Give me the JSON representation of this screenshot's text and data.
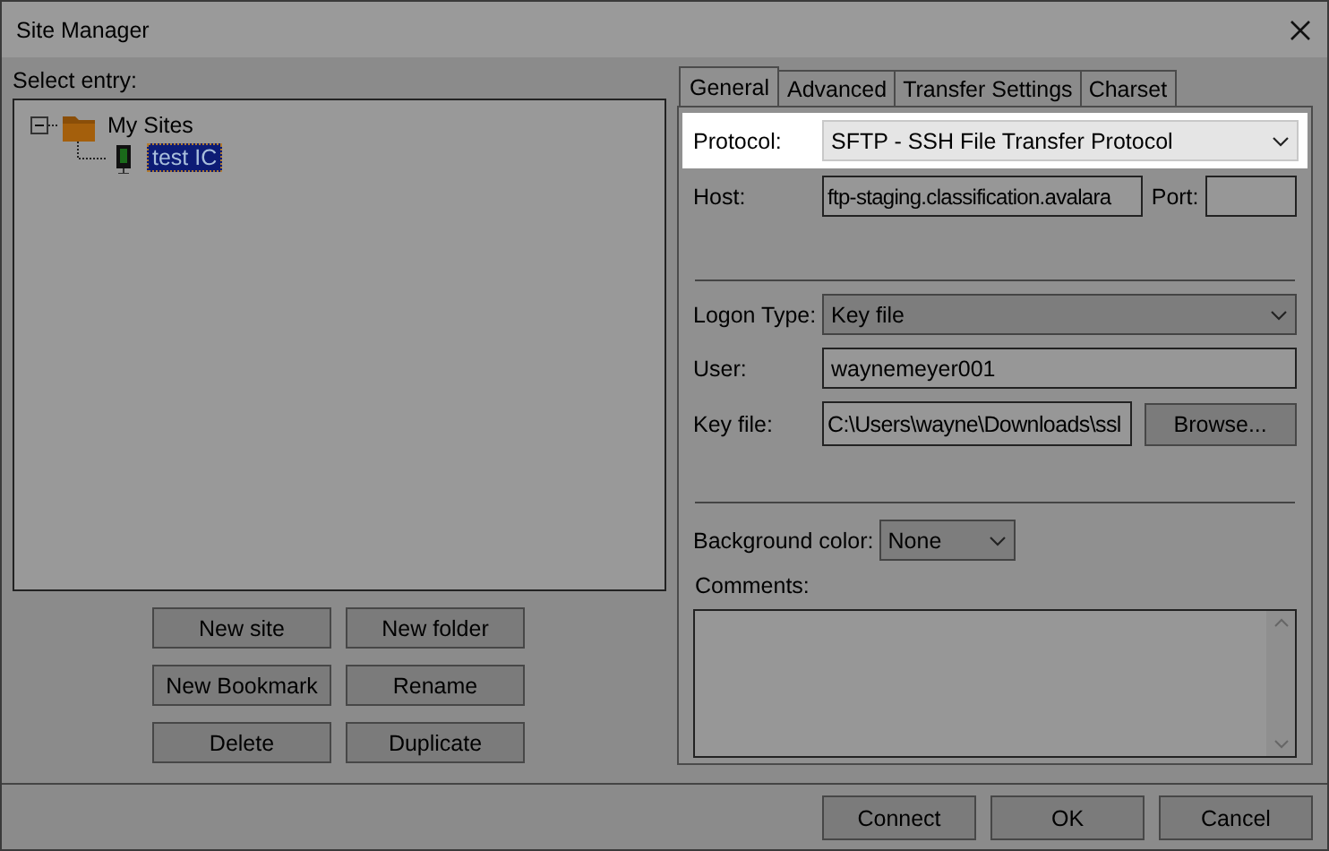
{
  "window": {
    "title": "Site Manager"
  },
  "select_entry_label": "Select entry:",
  "tree": [
    {
      "label": "My Sites",
      "kind": "folder",
      "expanded": true,
      "selected": false,
      "children": [
        {
          "label": "test IC",
          "kind": "site",
          "selected": true
        }
      ]
    }
  ],
  "site_buttons": [
    "New site",
    "New folder",
    "New Bookmark",
    "Rename",
    "Delete",
    "Duplicate"
  ],
  "tabs": [
    {
      "label": "General",
      "selected": true
    },
    {
      "label": "Advanced",
      "selected": false
    },
    {
      "label": "Transfer Settings",
      "selected": false
    },
    {
      "label": "Charset",
      "selected": false
    }
  ],
  "general": {
    "protocol": {
      "label": "Protocol:",
      "value": "SFTP - SSH File Transfer Protocol",
      "highlighted": true
    },
    "host": {
      "label": "Host:",
      "value": "ftp-staging.classification.avalara"
    },
    "port": {
      "label": "Port:"
    },
    "logon_type": {
      "label": "Logon Type:",
      "value": "Key file"
    },
    "user": {
      "label": "User:",
      "value": "waynemeyer001"
    },
    "key_file": {
      "label": "Key file:",
      "value": "C:\\Users\\wayne\\Downloads\\ssl",
      "button": "Browse..."
    },
    "background_color": {
      "label": "Background color:",
      "value": "None"
    },
    "comments": {
      "label": "Comments:"
    }
  },
  "dialog_buttons": [
    "Connect",
    "OK",
    "Cancel"
  ]
}
